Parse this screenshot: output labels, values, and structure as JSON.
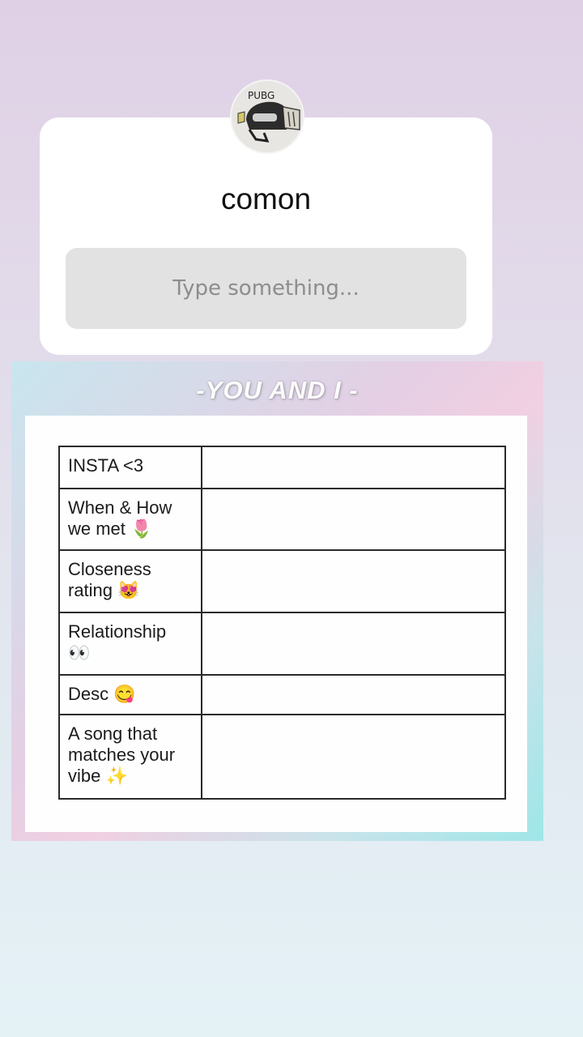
{
  "question_sticker": {
    "avatar_text": "PUBG",
    "title": "comon",
    "input_placeholder": "Type something..."
  },
  "template": {
    "heading": "-YOU AND I -",
    "rows": [
      {
        "label": "INSTA <3"
      },
      {
        "label": "When & How we met 🌷"
      },
      {
        "label": "Closeness rating 😻"
      },
      {
        "label": "Relationship 👀"
      },
      {
        "label": "Desc 😋"
      },
      {
        "label": "A song that matches your vibe ✨"
      }
    ]
  }
}
